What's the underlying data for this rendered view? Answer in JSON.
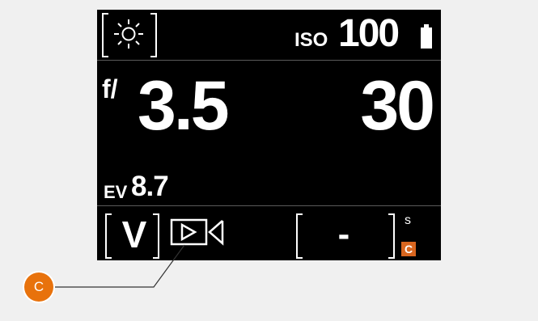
{
  "top_bar": {
    "wb_icon": "sun-icon",
    "iso_label": "ISO",
    "iso_value": "100",
    "battery_icon": "battery-icon"
  },
  "exposure": {
    "aperture_prefix": "f/",
    "aperture_value": "3.5",
    "shutter_value": "30"
  },
  "ev": {
    "label": "EV",
    "value": "8.7"
  },
  "bottom_bar": {
    "mode_letter": "V",
    "video_icon": "video-camera-icon",
    "setting_value": "-",
    "unit_label": "s",
    "badge": "C"
  },
  "callout": {
    "label": "C"
  },
  "colors": {
    "screen": "#000000",
    "accent": "#e8720c",
    "badge": "#d9661f",
    "divider": "#5a5a5a"
  }
}
